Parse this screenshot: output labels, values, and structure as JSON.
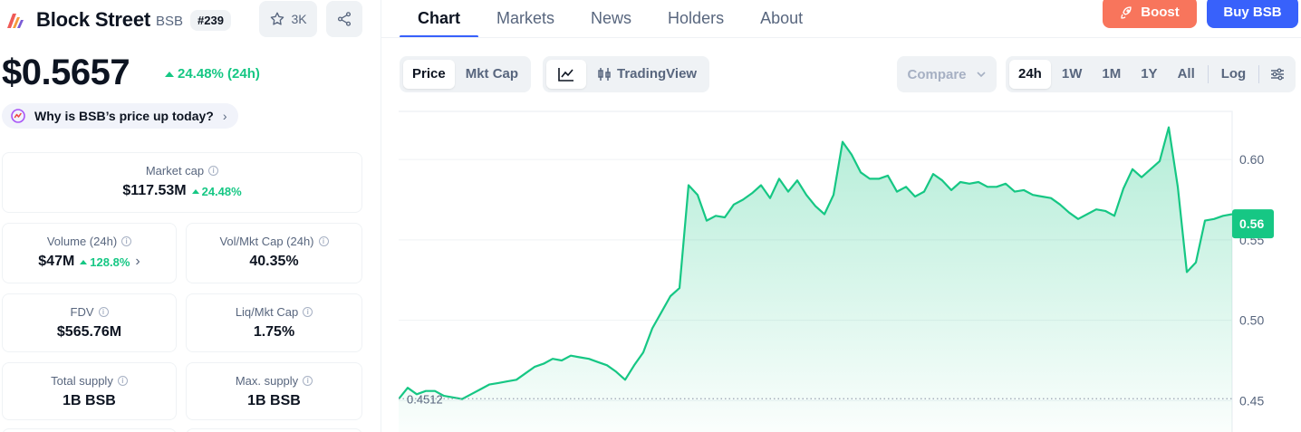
{
  "coin": {
    "name": "Block Street",
    "symbol": "BSB",
    "rank": "#239",
    "watchlist_count": "3K",
    "price": "$0.5657",
    "change_24h": "24.48% (24h)",
    "why_prompt": "Why is BSB’s price up today?"
  },
  "stats": {
    "market_cap": {
      "label": "Market cap",
      "value": "$117.53M",
      "change": "24.48%"
    },
    "volume": {
      "label": "Volume (24h)",
      "value": "$47M",
      "change": "128.8%"
    },
    "vol_mkt_cap": {
      "label": "Vol/Mkt Cap (24h)",
      "value": "40.35%"
    },
    "fdv": {
      "label": "FDV",
      "value": "$565.76M"
    },
    "liq_mkt_cap": {
      "label": "Liq/Mkt Cap",
      "value": "1.75%"
    },
    "total_supply": {
      "label": "Total supply",
      "value": "1B BSB"
    },
    "max_supply": {
      "label": "Max. supply",
      "value": "1B BSB"
    }
  },
  "tabs": [
    {
      "label": "Chart",
      "active": true
    },
    {
      "label": "Markets",
      "active": false
    },
    {
      "label": "News",
      "active": false
    },
    {
      "label": "Holders",
      "active": false
    },
    {
      "label": "About",
      "active": false
    }
  ],
  "actions": {
    "boost": "Boost",
    "buy": "Buy BSB"
  },
  "toolbar": {
    "metric": {
      "price": "Price",
      "mkt_cap": "Mkt Cap"
    },
    "tradingview": "TradingView",
    "compare": "Compare",
    "ranges": [
      "24h",
      "1W",
      "1M",
      "1Y",
      "All"
    ],
    "active_range": "24h",
    "log": "Log"
  },
  "colors": {
    "up": "#16c784",
    "down": "#ea3943",
    "accent": "#3861fb",
    "boost": "#f8755c"
  },
  "chart_data": {
    "type": "area",
    "series": [
      {
        "values": [
          0.451,
          0.458,
          0.454,
          0.456,
          0.456,
          0.453,
          0.452,
          0.451,
          0.454,
          0.457,
          0.46,
          0.461,
          0.462,
          0.463,
          0.467,
          0.471,
          0.473,
          0.476,
          0.475,
          0.478,
          0.477,
          0.476,
          0.474,
          0.472,
          0.468,
          0.463,
          0.472,
          0.48,
          0.495,
          0.505,
          0.515,
          0.52,
          0.584,
          0.578,
          0.562,
          0.565,
          0.564,
          0.572,
          0.575,
          0.579,
          0.584,
          0.576,
          0.588,
          0.58,
          0.587,
          0.578,
          0.571,
          0.566,
          0.578,
          0.611,
          0.603,
          0.592,
          0.588,
          0.588,
          0.59,
          0.58,
          0.583,
          0.577,
          0.58,
          0.591,
          0.587,
          0.581,
          0.586,
          0.585,
          0.586,
          0.583,
          0.583,
          0.585,
          0.58,
          0.581,
          0.578,
          0.577,
          0.576,
          0.572,
          0.567,
          0.563,
          0.566,
          0.569,
          0.568,
          0.565,
          0.582,
          0.594,
          0.589,
          0.594,
          0.599,
          0.62,
          0.583,
          0.53,
          0.536,
          0.562,
          0.563,
          0.565,
          0.566
        ],
        "current": 0.56,
        "open": 0.4512
      }
    ],
    "y_ticks": [
      0.6,
      0.55,
      0.5,
      0.45
    ],
    "ylim": [
      0.4305,
      0.6305
    ],
    "grid": "horizontal",
    "current_label": "0.56",
    "baseline_label": "0.4512"
  }
}
